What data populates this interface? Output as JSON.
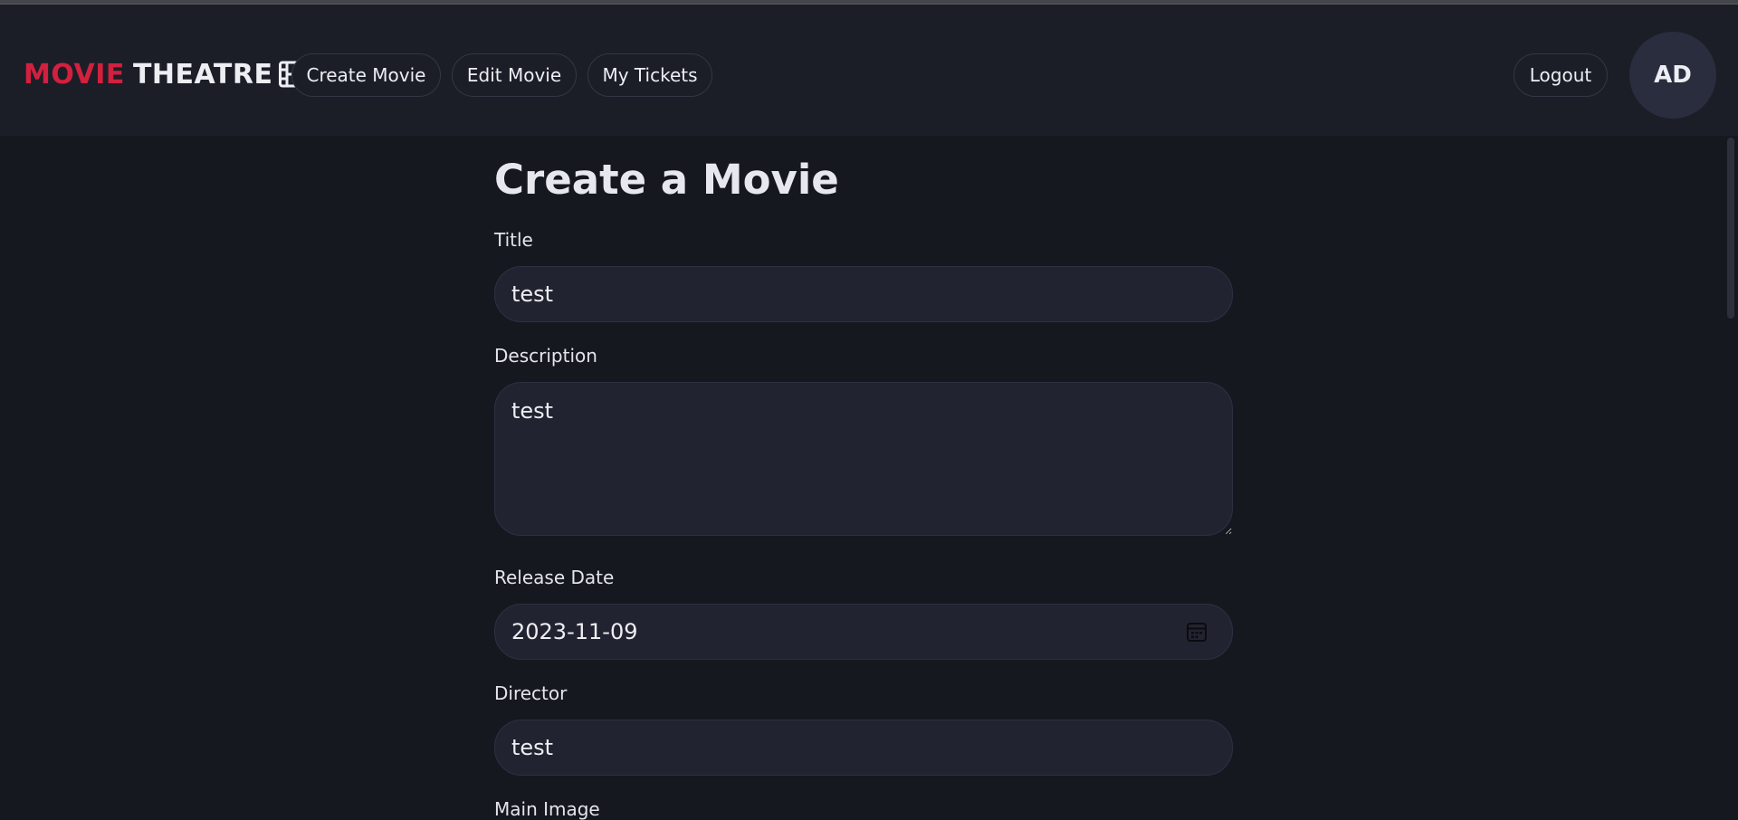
{
  "brand": {
    "word1": "MOVIE",
    "word2": "THEATRE",
    "icon": "film-icon"
  },
  "nav": {
    "create_movie": "Create Movie",
    "edit_movie": "Edit Movie",
    "my_tickets": "My Tickets"
  },
  "user": {
    "logout": "Logout",
    "initials": "AD"
  },
  "form": {
    "heading": "Create a Movie",
    "title_label": "Title",
    "title_value": "test",
    "description_label": "Description",
    "description_value": "test",
    "release_label": "Release Date",
    "release_value": "2023-11-09",
    "director_label": "Director",
    "director_value": "test",
    "main_image_label": "Main Image"
  },
  "colors": {
    "accent": "#d2203f",
    "background": "#161820",
    "header": "#1b1e27",
    "field": "#212430"
  }
}
